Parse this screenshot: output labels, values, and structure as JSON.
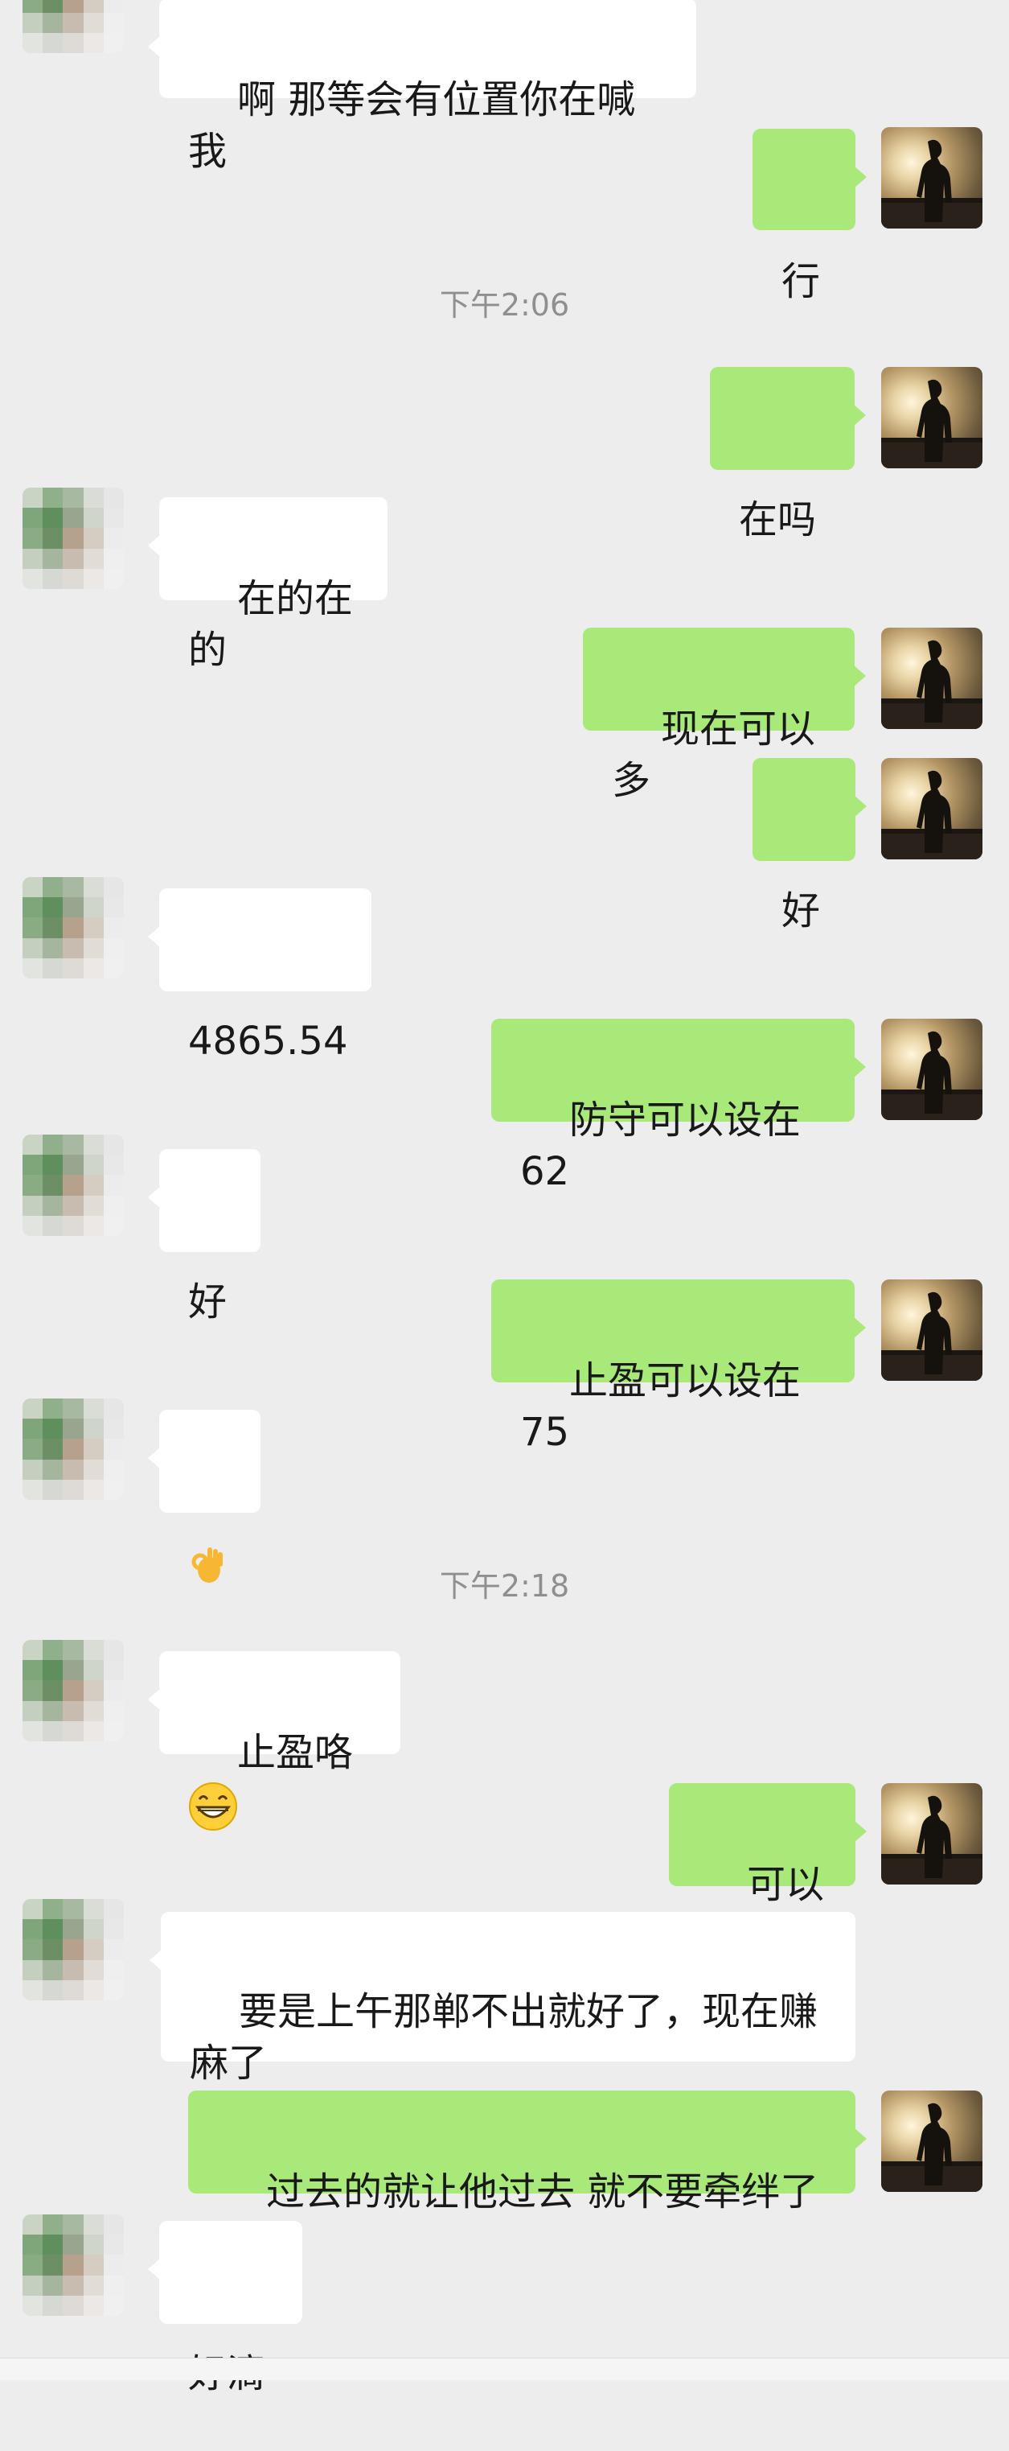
{
  "chat": {
    "messages": [
      {
        "id": "m1",
        "side": "in",
        "text": "啊 那等会有位置你在喊我"
      },
      {
        "id": "m2",
        "side": "out",
        "text": "行"
      },
      {
        "id": "t1",
        "type": "time",
        "text": "下午2:06"
      },
      {
        "id": "m3",
        "side": "out",
        "text": "在吗"
      },
      {
        "id": "m4",
        "side": "in",
        "text": "在的在的"
      },
      {
        "id": "m5",
        "side": "out",
        "text": "现在可以多"
      },
      {
        "id": "m6",
        "side": "out",
        "text": "好"
      },
      {
        "id": "m7",
        "side": "in",
        "text": "4865.54"
      },
      {
        "id": "m8",
        "side": "out",
        "text": "防守可以设在62"
      },
      {
        "id": "m9",
        "side": "in",
        "text": "好"
      },
      {
        "id": "m10",
        "side": "out",
        "text": "止盈可以设在75"
      },
      {
        "id": "m11",
        "side": "in",
        "emoji": "ok-hand"
      },
      {
        "id": "t2",
        "type": "time",
        "text": "下午2:18"
      },
      {
        "id": "m12",
        "side": "in",
        "text": "止盈咯",
        "emoji": "grinning-face"
      },
      {
        "id": "m13",
        "side": "out",
        "text": "可以的"
      },
      {
        "id": "m14",
        "side": "in",
        "text": "要是上午那郸不出就好了，现在赚\n麻了"
      },
      {
        "id": "m15",
        "side": "out",
        "text": "过去的就让他过去 就不要牵绊了"
      },
      {
        "id": "m16",
        "side": "in",
        "text": "好滴"
      }
    ]
  },
  "colors": {
    "background": "#ededed",
    "incoming_bubble": "#ffffff",
    "outgoing_bubble": "#a9e97a",
    "timestamp": "#8f8f8f"
  },
  "icons": {
    "contact_avatar": "pixelated-avatar",
    "self_avatar": "silhouette-avatar"
  }
}
